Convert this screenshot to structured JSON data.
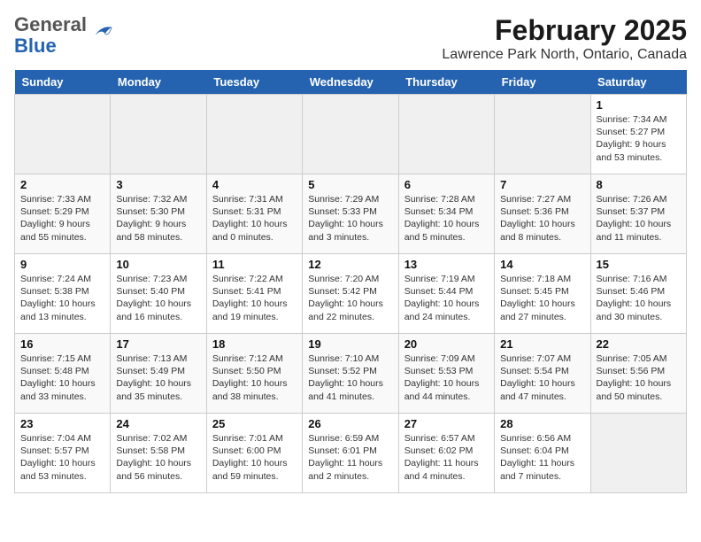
{
  "header": {
    "logo_general": "General",
    "logo_blue": "Blue",
    "main_title": "February 2025",
    "subtitle": "Lawrence Park North, Ontario, Canada"
  },
  "weekdays": [
    "Sunday",
    "Monday",
    "Tuesday",
    "Wednesday",
    "Thursday",
    "Friday",
    "Saturday"
  ],
  "weeks": [
    [
      {
        "day": "",
        "info": ""
      },
      {
        "day": "",
        "info": ""
      },
      {
        "day": "",
        "info": ""
      },
      {
        "day": "",
        "info": ""
      },
      {
        "day": "",
        "info": ""
      },
      {
        "day": "",
        "info": ""
      },
      {
        "day": "1",
        "info": "Sunrise: 7:34 AM\nSunset: 5:27 PM\nDaylight: 9 hours and 53 minutes."
      }
    ],
    [
      {
        "day": "2",
        "info": "Sunrise: 7:33 AM\nSunset: 5:29 PM\nDaylight: 9 hours and 55 minutes."
      },
      {
        "day": "3",
        "info": "Sunrise: 7:32 AM\nSunset: 5:30 PM\nDaylight: 9 hours and 58 minutes."
      },
      {
        "day": "4",
        "info": "Sunrise: 7:31 AM\nSunset: 5:31 PM\nDaylight: 10 hours and 0 minutes."
      },
      {
        "day": "5",
        "info": "Sunrise: 7:29 AM\nSunset: 5:33 PM\nDaylight: 10 hours and 3 minutes."
      },
      {
        "day": "6",
        "info": "Sunrise: 7:28 AM\nSunset: 5:34 PM\nDaylight: 10 hours and 5 minutes."
      },
      {
        "day": "7",
        "info": "Sunrise: 7:27 AM\nSunset: 5:36 PM\nDaylight: 10 hours and 8 minutes."
      },
      {
        "day": "8",
        "info": "Sunrise: 7:26 AM\nSunset: 5:37 PM\nDaylight: 10 hours and 11 minutes."
      }
    ],
    [
      {
        "day": "9",
        "info": "Sunrise: 7:24 AM\nSunset: 5:38 PM\nDaylight: 10 hours and 13 minutes."
      },
      {
        "day": "10",
        "info": "Sunrise: 7:23 AM\nSunset: 5:40 PM\nDaylight: 10 hours and 16 minutes."
      },
      {
        "day": "11",
        "info": "Sunrise: 7:22 AM\nSunset: 5:41 PM\nDaylight: 10 hours and 19 minutes."
      },
      {
        "day": "12",
        "info": "Sunrise: 7:20 AM\nSunset: 5:42 PM\nDaylight: 10 hours and 22 minutes."
      },
      {
        "day": "13",
        "info": "Sunrise: 7:19 AM\nSunset: 5:44 PM\nDaylight: 10 hours and 24 minutes."
      },
      {
        "day": "14",
        "info": "Sunrise: 7:18 AM\nSunset: 5:45 PM\nDaylight: 10 hours and 27 minutes."
      },
      {
        "day": "15",
        "info": "Sunrise: 7:16 AM\nSunset: 5:46 PM\nDaylight: 10 hours and 30 minutes."
      }
    ],
    [
      {
        "day": "16",
        "info": "Sunrise: 7:15 AM\nSunset: 5:48 PM\nDaylight: 10 hours and 33 minutes."
      },
      {
        "day": "17",
        "info": "Sunrise: 7:13 AM\nSunset: 5:49 PM\nDaylight: 10 hours and 35 minutes."
      },
      {
        "day": "18",
        "info": "Sunrise: 7:12 AM\nSunset: 5:50 PM\nDaylight: 10 hours and 38 minutes."
      },
      {
        "day": "19",
        "info": "Sunrise: 7:10 AM\nSunset: 5:52 PM\nDaylight: 10 hours and 41 minutes."
      },
      {
        "day": "20",
        "info": "Sunrise: 7:09 AM\nSunset: 5:53 PM\nDaylight: 10 hours and 44 minutes."
      },
      {
        "day": "21",
        "info": "Sunrise: 7:07 AM\nSunset: 5:54 PM\nDaylight: 10 hours and 47 minutes."
      },
      {
        "day": "22",
        "info": "Sunrise: 7:05 AM\nSunset: 5:56 PM\nDaylight: 10 hours and 50 minutes."
      }
    ],
    [
      {
        "day": "23",
        "info": "Sunrise: 7:04 AM\nSunset: 5:57 PM\nDaylight: 10 hours and 53 minutes."
      },
      {
        "day": "24",
        "info": "Sunrise: 7:02 AM\nSunset: 5:58 PM\nDaylight: 10 hours and 56 minutes."
      },
      {
        "day": "25",
        "info": "Sunrise: 7:01 AM\nSunset: 6:00 PM\nDaylight: 10 hours and 59 minutes."
      },
      {
        "day": "26",
        "info": "Sunrise: 6:59 AM\nSunset: 6:01 PM\nDaylight: 11 hours and 2 minutes."
      },
      {
        "day": "27",
        "info": "Sunrise: 6:57 AM\nSunset: 6:02 PM\nDaylight: 11 hours and 4 minutes."
      },
      {
        "day": "28",
        "info": "Sunrise: 6:56 AM\nSunset: 6:04 PM\nDaylight: 11 hours and 7 minutes."
      },
      {
        "day": "",
        "info": ""
      }
    ]
  ]
}
